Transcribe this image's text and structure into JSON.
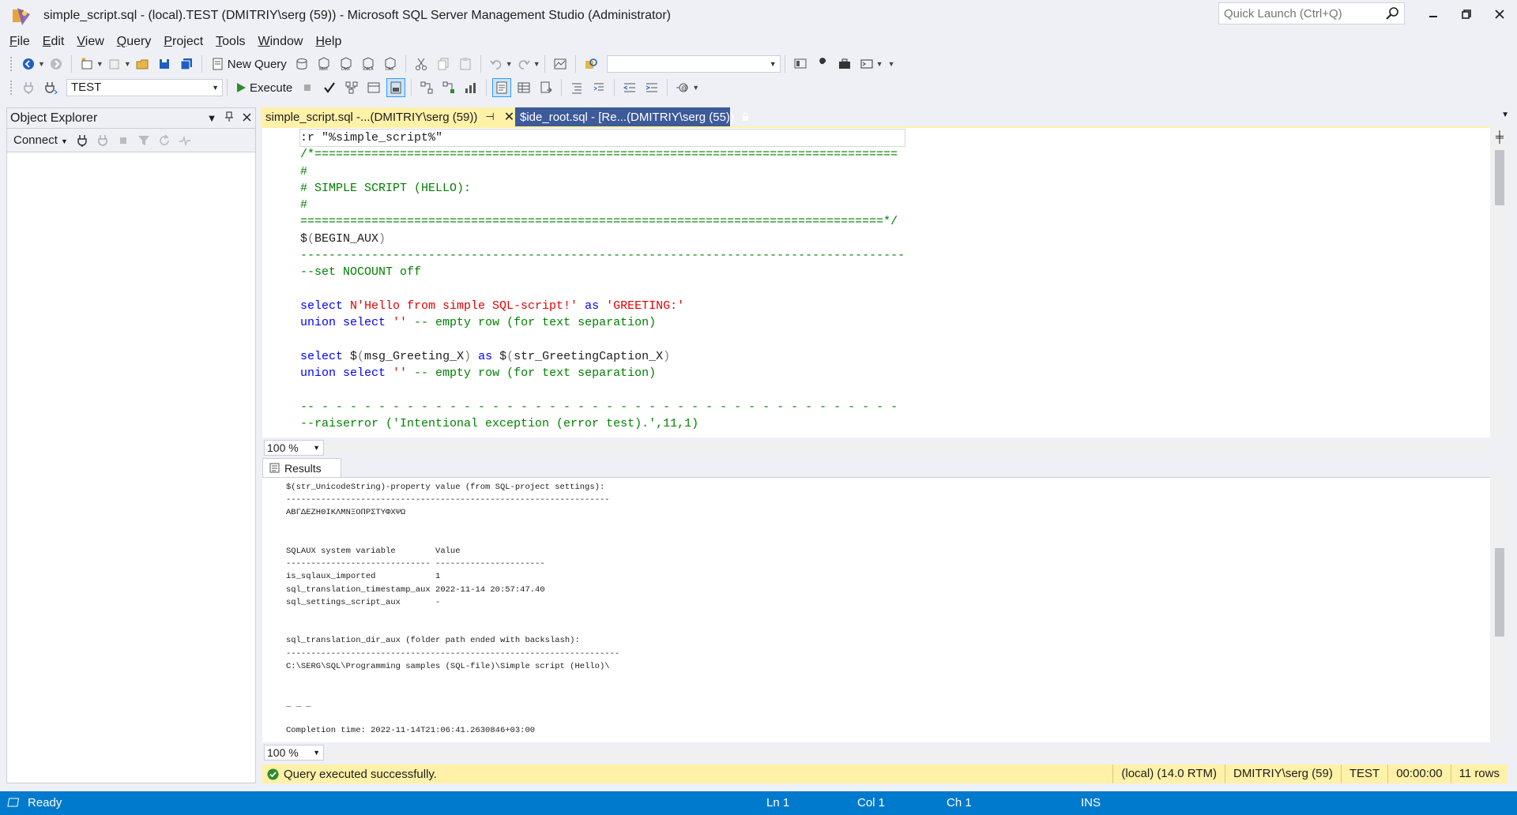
{
  "window": {
    "title": "simple_script.sql - (local).TEST (DMITRIY\\serg (59)) - Microsoft SQL Server Management Studio (Administrator)",
    "quick_launch_placeholder": "Quick Launch (Ctrl+Q)"
  },
  "menu": [
    "File",
    "Edit",
    "View",
    "Query",
    "Project",
    "Tools",
    "Window",
    "Help"
  ],
  "toolbar": {
    "new_query_label": "New Query",
    "database_value": "TEST",
    "execute_label": "Execute",
    "solution_config_value": ""
  },
  "object_explorer": {
    "title": "Object Explorer",
    "connect_label": "Connect"
  },
  "tabs": {
    "active_label": "simple_script.sql -...(DMITRIY\\serg (59))",
    "inactive_label": "$ide_root.sql -  [Re...(DMITRIY\\serg (55))"
  },
  "editor": {
    "lines": [
      [
        {
          "t": ":r \"%simple_script%\"",
          "c": "c-plain"
        }
      ],
      [
        {
          "t": "/*==================================================================================",
          "c": "c-comment"
        }
      ],
      [
        {
          "t": "#",
          "c": "c-comment"
        }
      ],
      [
        {
          "t": "# SIMPLE SCRIPT (HELLO):",
          "c": "c-comment"
        }
      ],
      [
        {
          "t": "#",
          "c": "c-comment"
        }
      ],
      [
        {
          "t": "==================================================================================*/",
          "c": "c-comment"
        }
      ],
      [
        {
          "t": "$",
          "c": "c-plain"
        },
        {
          "t": "(",
          "c": "c-gray"
        },
        {
          "t": "BEGIN_AUX",
          "c": "c-plain"
        },
        {
          "t": ")",
          "c": "c-gray"
        }
      ],
      [
        {
          "t": "-------------------------------------------------------------------------------------",
          "c": "c-comment"
        }
      ],
      [
        {
          "t": "--set NOCOUNT off",
          "c": "c-comment"
        }
      ],
      [],
      [
        {
          "t": "select ",
          "c": "c-kw"
        },
        {
          "t": "N'Hello from simple SQL-script!'",
          "c": "c-str"
        },
        {
          "t": " as ",
          "c": "c-kw"
        },
        {
          "t": "'GREETING:'",
          "c": "c-str"
        }
      ],
      [
        {
          "t": "union select ",
          "c": "c-kw"
        },
        {
          "t": "''",
          "c": "c-str"
        },
        {
          "t": " -- empty row (for text separation)",
          "c": "c-comment"
        }
      ],
      [],
      [
        {
          "t": "select ",
          "c": "c-kw"
        },
        {
          "t": "$",
          "c": "c-plain"
        },
        {
          "t": "(",
          "c": "c-gray"
        },
        {
          "t": "msg_Greeting_X",
          "c": "c-plain"
        },
        {
          "t": ")",
          "c": "c-gray"
        },
        {
          "t": " as ",
          "c": "c-kw"
        },
        {
          "t": "$",
          "c": "c-plain"
        },
        {
          "t": "(",
          "c": "c-gray"
        },
        {
          "t": "str_GreetingCaption_X",
          "c": "c-plain"
        },
        {
          "t": ")",
          "c": "c-gray"
        }
      ],
      [
        {
          "t": "union select ",
          "c": "c-kw"
        },
        {
          "t": "''",
          "c": "c-str"
        },
        {
          "t": " -- empty row (for text separation)",
          "c": "c-comment"
        }
      ],
      [],
      [
        {
          "t": "-- - - - - - - - - - - - - - - - - - - - - - - - - - - - - - - - - - - - - - - - - -",
          "c": "c-comment"
        }
      ],
      [
        {
          "t": "--raiserror ('Intentional exception (error test).',11,1)",
          "c": "c-comment"
        }
      ]
    ],
    "zoom": "100 %"
  },
  "results": {
    "tab_label": "Results",
    "lines": [
      "$(str_UnicodeString)-property value (from SQL-project settings):",
      "-----------------------------------------------------------------",
      "ΑΒΓΔΕΖΗΘΙΚΛΜΝΞΟΠΡΣΤΥΦΧΨΩ",
      "",
      "",
      "SQLAUX system variable        Value",
      "----------------------------- ----------------------",
      "is_sqlaux_imported            1",
      "sql_translation_timestamp_aux 2022-11-14 20:57:47.40",
      "sql_settings_script_aux       -",
      "",
      "",
      "sql_translation_dir_aux (folder path ended with backslash):",
      "-------------------------------------------------------------------",
      "C:\\SERG\\SQL\\Programming samples (SQL-file)\\Simple script (Hello)\\",
      "",
      "",
      "_ _ _",
      "",
      "Completion time: 2022-11-14T21:06:41.2630846+03:00"
    ],
    "zoom": "100 %"
  },
  "query_status": {
    "message": "Query executed successfully.",
    "server": "(local) (14.0 RTM)",
    "user": "DMITRIY\\serg (59)",
    "database": "TEST",
    "elapsed": "00:00:00",
    "rows": "11 rows"
  },
  "statusbar": {
    "state": "Ready",
    "ln": "Ln 1",
    "col": "Col 1",
    "ch": "Ch 1",
    "mode": "INS"
  },
  "colors": {
    "accent": "#007acc",
    "active_tab": "#fff1a8",
    "inactive_tab": "#3d5a99"
  }
}
